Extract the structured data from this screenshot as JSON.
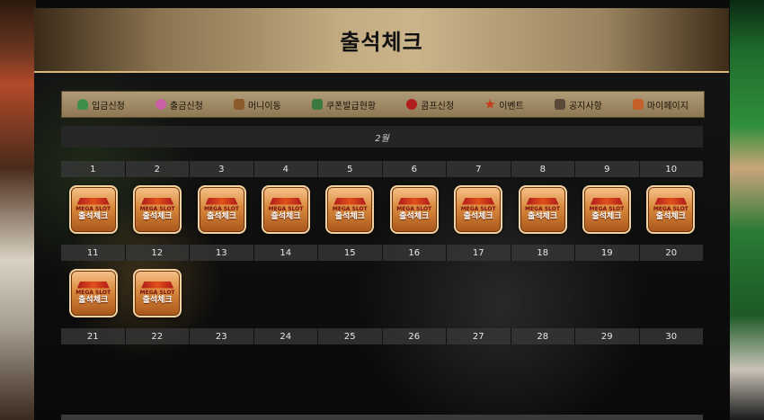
{
  "header": {
    "title": "출석체크"
  },
  "menu": [
    {
      "label": "입금신청",
      "icon": "money-bag-icon",
      "color": "#3f8f4a"
    },
    {
      "label": "출금신청",
      "icon": "donut-coin-icon",
      "color": "#c95fa4"
    },
    {
      "label": "머니이동",
      "icon": "chest-icon",
      "color": "#8a5a2a"
    },
    {
      "label": "쿠폰발급현황",
      "icon": "gift-icon",
      "color": "#3a7a3f"
    },
    {
      "label": "콤프신청",
      "icon": "cherry-icon",
      "color": "#b21d1d"
    },
    {
      "label": "이벤트",
      "icon": "star-badge-icon",
      "color": "#c23b1b"
    },
    {
      "label": "공지사항",
      "icon": "scroll-icon",
      "color": "#5b4a39"
    },
    {
      "label": "마이페이지",
      "icon": "trophy-icon",
      "color": "#c6602a"
    }
  ],
  "calendar": {
    "month": "2월",
    "week1_days": [
      "1",
      "2",
      "3",
      "4",
      "5",
      "6",
      "7",
      "8",
      "9",
      "10"
    ],
    "week2_days": [
      "11",
      "12",
      "13",
      "14",
      "15",
      "16",
      "17",
      "18",
      "19",
      "20"
    ],
    "week3_days": [
      "21",
      "22",
      "23",
      "24",
      "25",
      "26",
      "27",
      "28",
      "29",
      "30"
    ],
    "stamp": {
      "brand": "MEGA SLOT",
      "text": "출석체크"
    },
    "checked_week1": [
      true,
      true,
      true,
      true,
      true,
      true,
      true,
      true,
      true,
      true
    ],
    "checked_week2": [
      true,
      true,
      false,
      false,
      false,
      false,
      false,
      false,
      false,
      false
    ]
  }
}
